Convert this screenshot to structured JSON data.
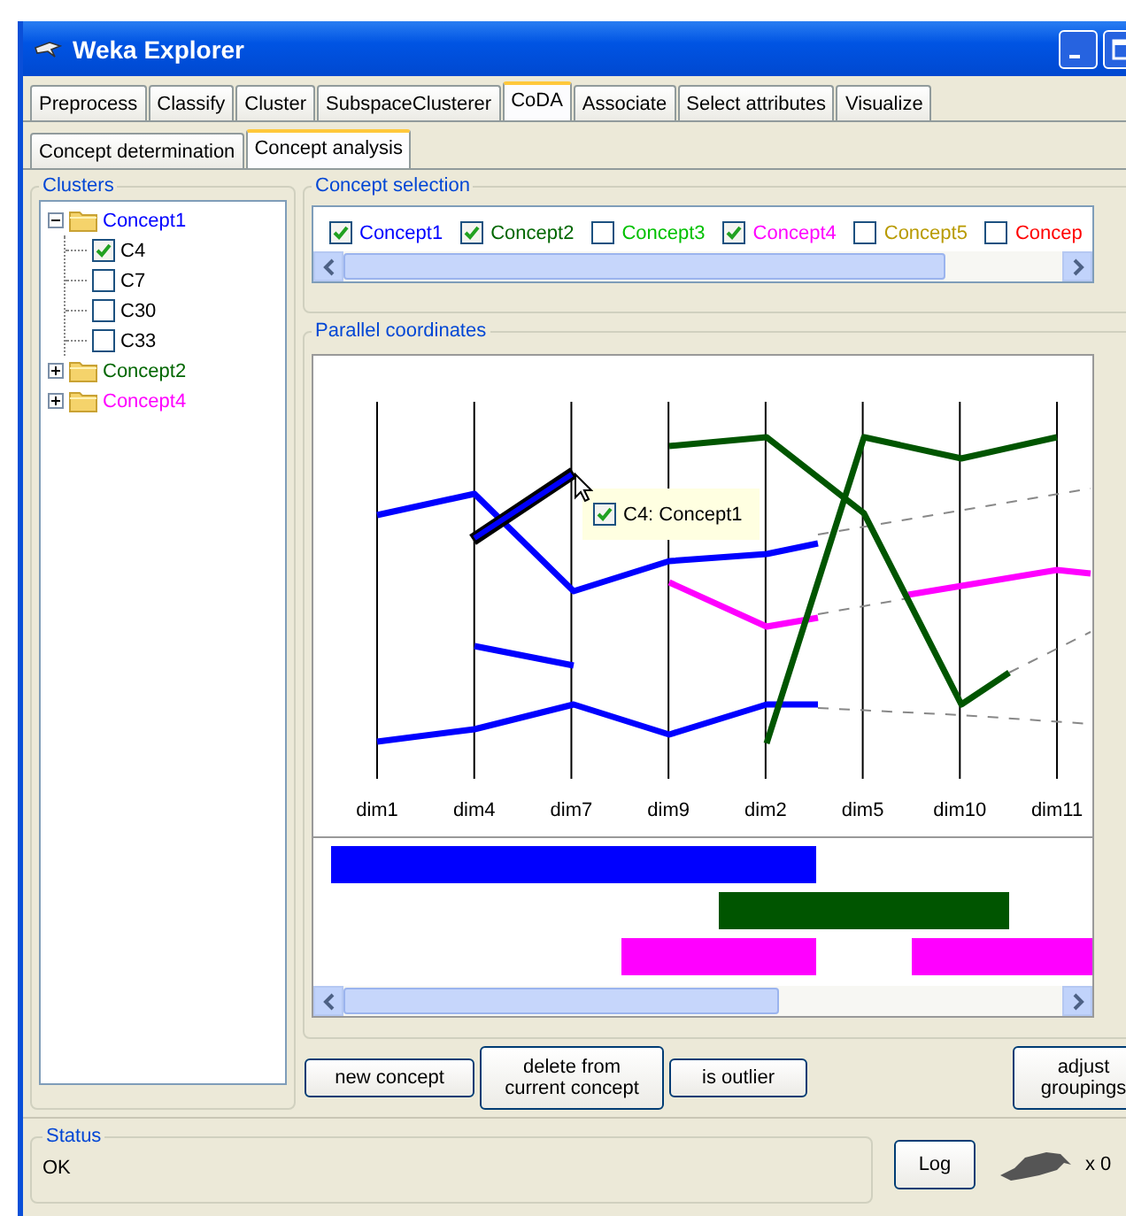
{
  "window": {
    "title": "Weka Explorer"
  },
  "tabs": [
    {
      "label": "Preprocess",
      "selected": false
    },
    {
      "label": "Classify",
      "selected": false
    },
    {
      "label": "Cluster",
      "selected": false
    },
    {
      "label": "SubspaceClusterer",
      "selected": false
    },
    {
      "label": "CoDA",
      "selected": true
    },
    {
      "label": "Associate",
      "selected": false
    },
    {
      "label": "Select attributes",
      "selected": false
    },
    {
      "label": "Visualize",
      "selected": false
    }
  ],
  "subtabs": [
    {
      "label": "Concept determination",
      "selected": false
    },
    {
      "label": "Concept analysis",
      "selected": true
    }
  ],
  "clusters": {
    "title": "Clusters",
    "tree": [
      {
        "label": "Concept1",
        "color": "#0000ff",
        "expanded": true,
        "children": [
          {
            "label": "C4",
            "checked": true
          },
          {
            "label": "C7",
            "checked": false
          },
          {
            "label": "C30",
            "checked": false
          },
          {
            "label": "C33",
            "checked": false
          }
        ]
      },
      {
        "label": "Concept2",
        "color": "#006600",
        "expanded": false
      },
      {
        "label": "Concept4",
        "color": "#ff00ff",
        "expanded": false
      }
    ]
  },
  "concept_selection": {
    "title": "Concept selection",
    "items": [
      {
        "label": "Concept1",
        "checked": true,
        "color": "#0000ff"
      },
      {
        "label": "Concept2",
        "checked": true,
        "color": "#006600"
      },
      {
        "label": "Concept3",
        "checked": false,
        "color": "#00c000"
      },
      {
        "label": "Concept4",
        "checked": true,
        "color": "#ff00ff"
      },
      {
        "label": "Concept5",
        "checked": false,
        "color": "#b89a00"
      },
      {
        "label": "Concep",
        "checked": false,
        "color": "#ff0000"
      }
    ]
  },
  "parallel_coordinates": {
    "title": "Parallel coordinates",
    "axes": [
      "dim1",
      "dim4",
      "dim7",
      "dim9",
      "dim2",
      "dim5",
      "dim10",
      "dim11"
    ],
    "tooltip": {
      "label": "C4: Concept1",
      "checked": true
    }
  },
  "buttons": [
    {
      "label": "new concept"
    },
    {
      "label": "delete from current concept"
    },
    {
      "label": "is outlier"
    },
    {
      "label": "adjust groupings"
    }
  ],
  "status": {
    "title": "Status",
    "text": "OK"
  },
  "log_button": "Log",
  "task_count": "x 0"
}
